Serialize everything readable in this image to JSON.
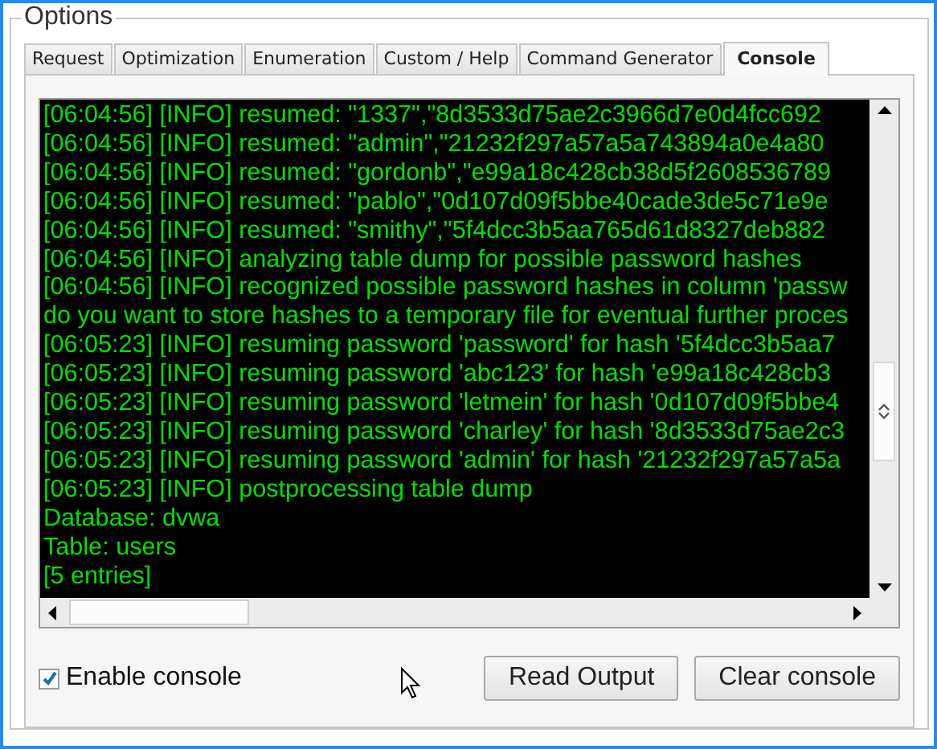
{
  "group": {
    "title": "Options"
  },
  "tabs": [
    {
      "label": "Request",
      "selected": false
    },
    {
      "label": "Optimization",
      "selected": false
    },
    {
      "label": "Enumeration",
      "selected": false
    },
    {
      "label": "Custom / Help",
      "selected": false
    },
    {
      "label": "Command Generator",
      "selected": false
    },
    {
      "label": "Console",
      "selected": true
    }
  ],
  "console": {
    "lines": [
      "[06:04:56] [INFO] resumed: \"1337\",\"8d3533d75ae2c3966d7e0d4fcc692",
      "[06:04:56] [INFO] resumed: \"admin\",\"21232f297a57a5a743894a0e4a80",
      "[06:04:56] [INFO] resumed: \"gordonb\",\"e99a18c428cb38d5f2608536789",
      "[06:04:56] [INFO] resumed: \"pablo\",\"0d107d09f5bbe40cade3de5c71e9e",
      "[06:04:56] [INFO] resumed: \"smithy\",\"5f4dcc3b5aa765d61d8327deb882",
      "[06:04:56] [INFO] analyzing table dump for possible password hashes",
      "[06:04:56] [INFO] recognized possible password hashes in column 'passw",
      "do you want to store hashes to a temporary file for eventual further proces",
      "[06:05:23] [INFO] resuming password 'password' for hash '5f4dcc3b5aa7",
      "[06:05:23] [INFO] resuming password 'abc123' for hash 'e99a18c428cb3",
      "[06:05:23] [INFO] resuming password 'letmein' for hash '0d107d09f5bbe4",
      "[06:05:23] [INFO] resuming password 'charley' for hash '8d3533d75ae2c3",
      "[06:05:23] [INFO] resuming password 'admin' for hash '21232f297a57a5a",
      "[06:05:23] [INFO] postprocessing table dump",
      "Database: dvwa",
      "Table: users",
      "[5 entries]"
    ]
  },
  "enable_console": {
    "label": "Enable console",
    "checked": true
  },
  "buttons": [
    "Read Output",
    "Clear console"
  ]
}
